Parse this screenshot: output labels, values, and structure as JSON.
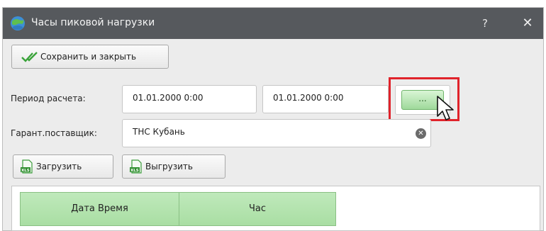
{
  "window": {
    "title": "Часы пиковой нагрузки",
    "help_label": "?",
    "close_label": "✕"
  },
  "toolbar": {
    "save_label": "Сохранить и закрыть"
  },
  "period": {
    "label": "Период расчета:",
    "date_from": "01.01.2000 0:00",
    "date_to": "01.01.2000 0:00",
    "picker_label": "..."
  },
  "supplier": {
    "label": "Гарант.поставщик:",
    "value": "ТНС Кубань"
  },
  "actions": {
    "upload_label": "Загрузить",
    "download_label": "Выгрузить"
  },
  "grid": {
    "columns": [
      "Дата Время",
      "Час"
    ]
  },
  "colors": {
    "titlebar": "#56595d",
    "accent_green": "#a9dea3",
    "highlight": "#e0232b"
  },
  "icons": {
    "app": "globe-icon",
    "save": "double-check-icon",
    "clear": "clear-icon",
    "upload": "xls-file-icon",
    "download": "xls-file-icon",
    "cursor": "mouse-pointer-icon"
  }
}
